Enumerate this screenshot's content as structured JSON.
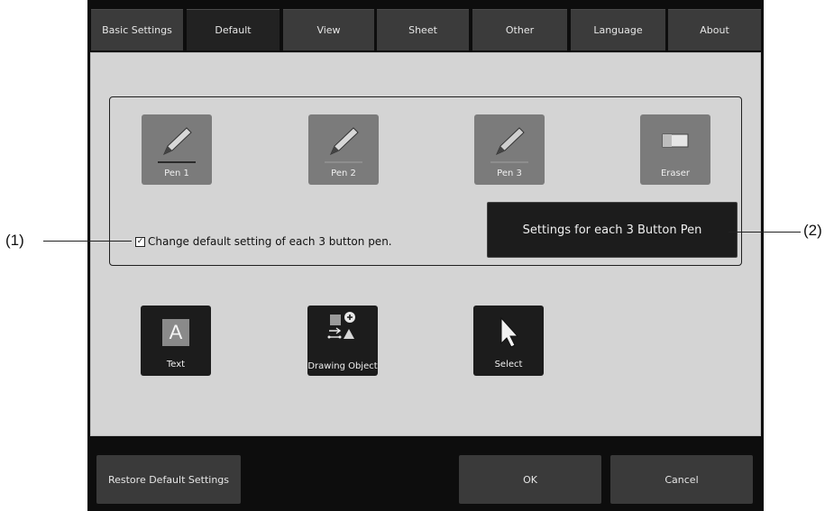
{
  "tabs": [
    {
      "label": "Basic Settings",
      "active": false
    },
    {
      "label": "Default",
      "active": true
    },
    {
      "label": "View",
      "active": false
    },
    {
      "label": "Sheet",
      "active": false
    },
    {
      "label": "Other",
      "active": false
    },
    {
      "label": "Language",
      "active": false
    },
    {
      "label": "About",
      "active": false
    }
  ],
  "pens": {
    "pen1": "Pen 1",
    "pen2": "Pen 2",
    "pen3": "Pen 3",
    "eraser": "Eraser"
  },
  "checkbox": {
    "label": "Change default setting of each 3 button pen.",
    "checked": true,
    "mark": "✓"
  },
  "settings_button": "Settings for each 3 Button Pen",
  "tools": {
    "text": "Text",
    "text_glyph": "A",
    "drawing_object": "Drawing Object",
    "select": "Select"
  },
  "footer": {
    "restore": "Restore Default Settings",
    "ok": "OK",
    "cancel": "Cancel"
  },
  "callouts": {
    "one": "(1)",
    "two": "(2)"
  }
}
